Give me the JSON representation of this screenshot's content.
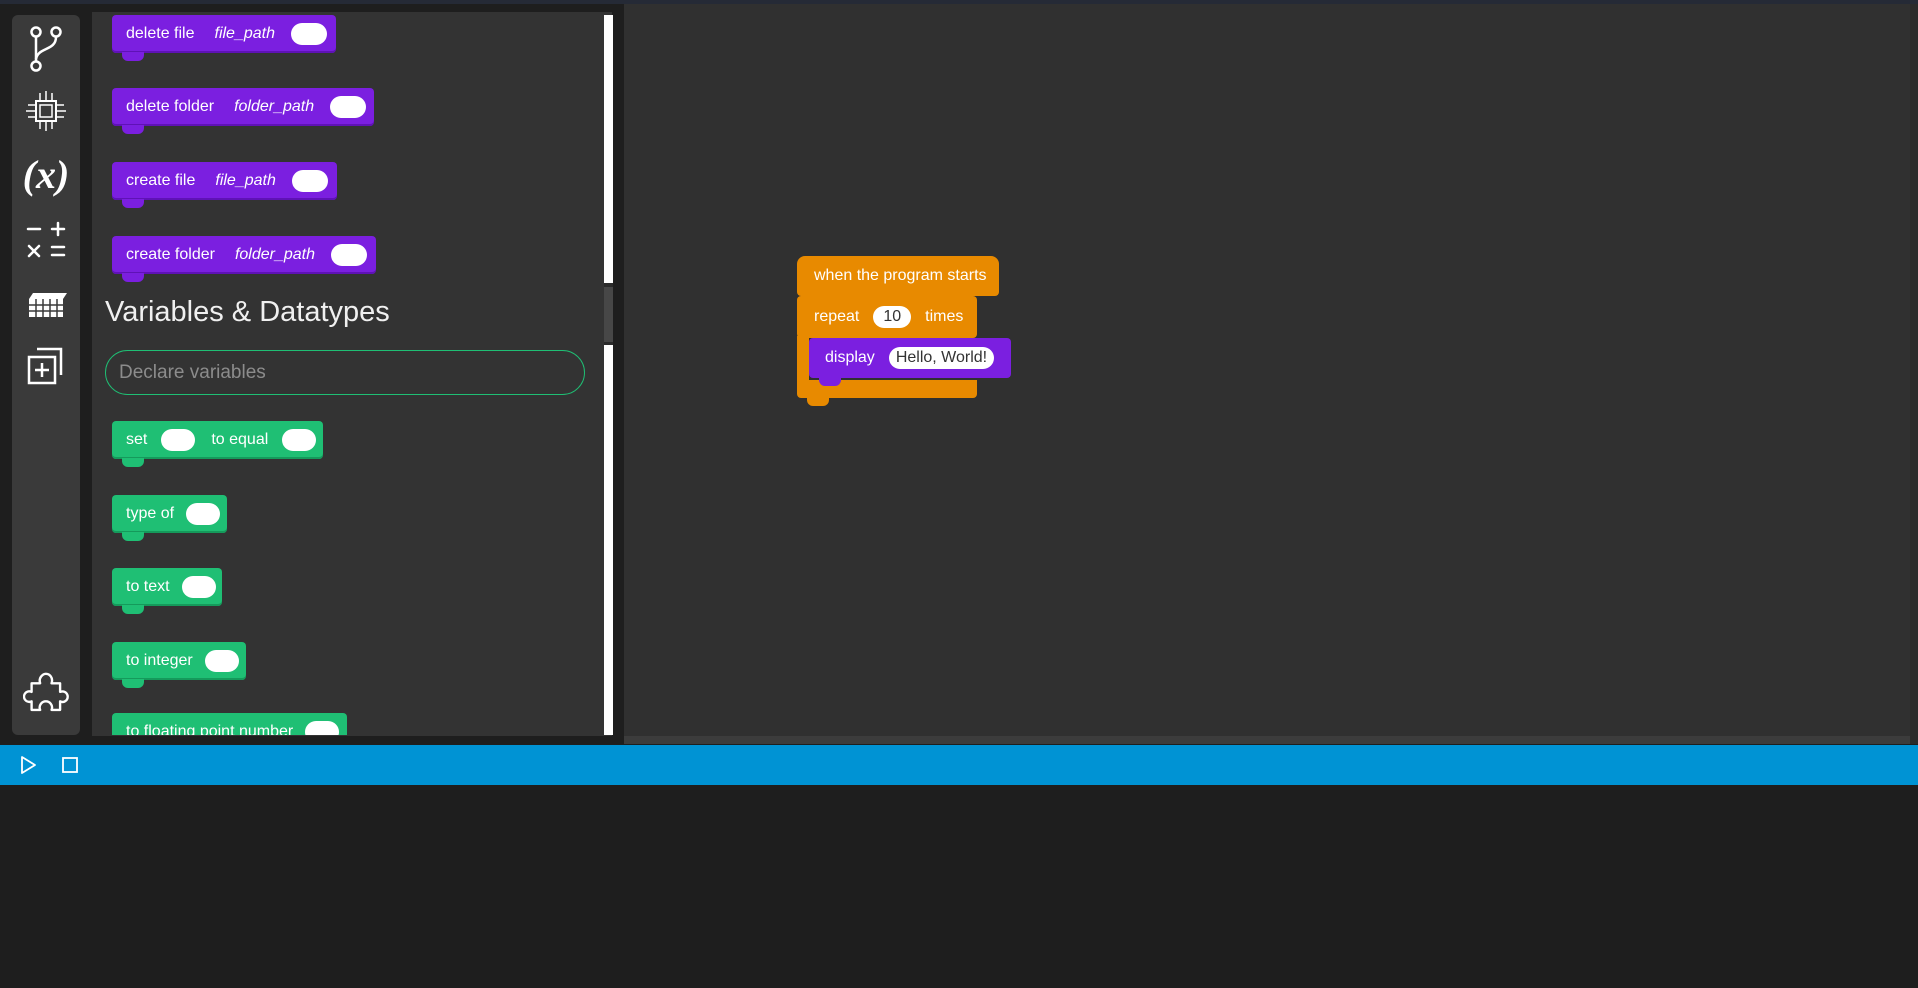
{
  "rail": {
    "items": [
      {
        "name": "control-flow-icon"
      },
      {
        "name": "hardware-icon"
      },
      {
        "name": "variables-icon",
        "glyph": "(x)"
      },
      {
        "name": "math-operators-icon"
      },
      {
        "name": "data-table-icon"
      },
      {
        "name": "add-component-icon"
      },
      {
        "name": "extensions-puzzle-icon"
      }
    ]
  },
  "flyout": {
    "file_blocks": [
      {
        "label": "delete file",
        "param": "file_path"
      },
      {
        "label": "delete folder",
        "param": "folder_path"
      },
      {
        "label": "create file",
        "param": "file_path"
      },
      {
        "label": "create folder",
        "param": "folder_path"
      }
    ],
    "section_title": "Variables & Datatypes",
    "declare_placeholder": "Declare variables",
    "variable_blocks": {
      "set": {
        "label": "set",
        "label2": "to equal"
      },
      "type_of": "type of",
      "to_text": "to text",
      "to_integer": "to integer",
      "to_float": "to floating point number"
    }
  },
  "workspace": {
    "hat_label": "when the program starts",
    "repeat": {
      "label": "repeat",
      "count": "10",
      "suffix": "times"
    },
    "display": {
      "label": "display",
      "value": "Hello, World!"
    }
  },
  "colors": {
    "file_blocks": "#7b1fe0",
    "variable_blocks": "#1fbf74",
    "control_blocks": "#e88a00",
    "statusbar": "#0093d4"
  },
  "statusbar": {
    "run": "run-icon",
    "stop": "stop-icon"
  }
}
